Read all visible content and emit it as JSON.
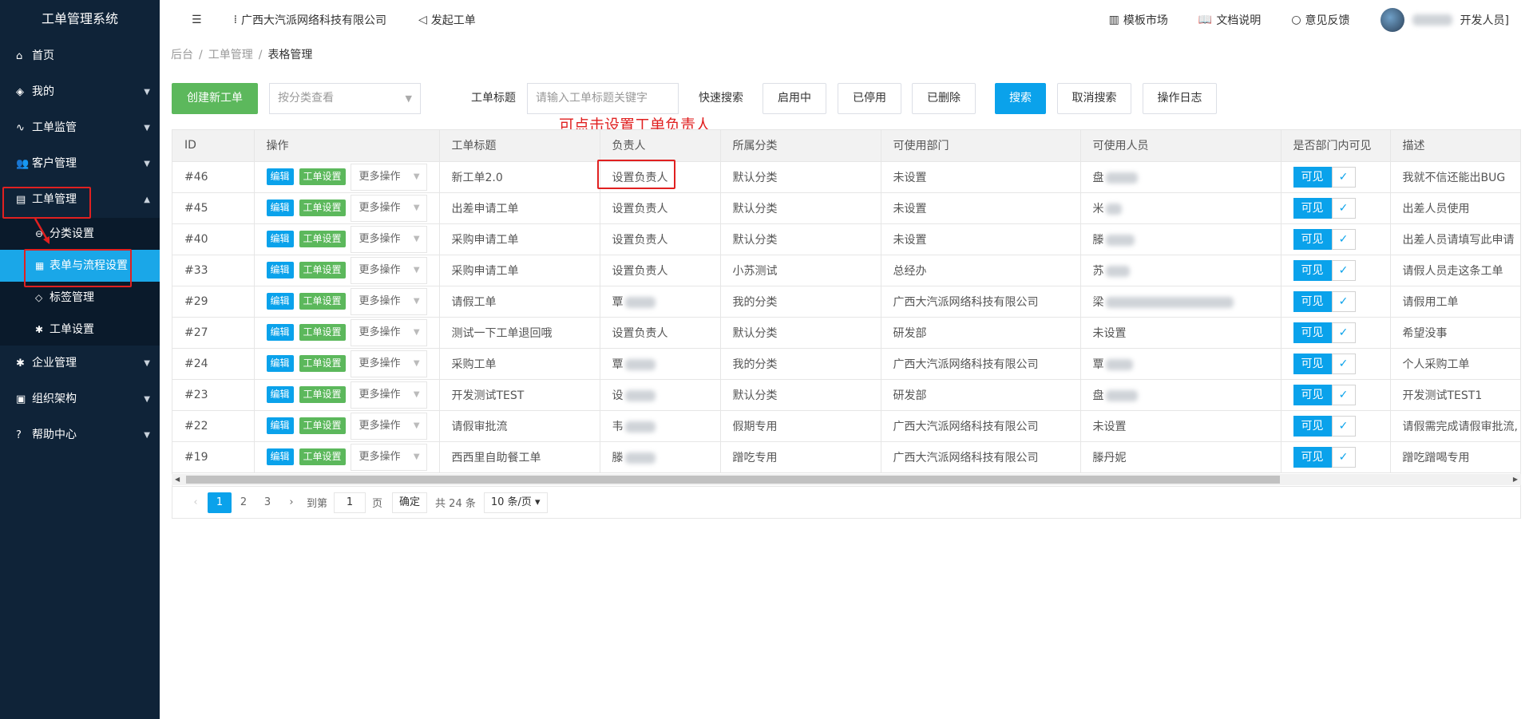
{
  "app_title": "工单管理系统",
  "sidebar": {
    "items": [
      {
        "label": "首页",
        "icon": "home-icon",
        "glyph": "⌂",
        "arrow": ""
      },
      {
        "label": "我的",
        "icon": "layers-icon",
        "glyph": "◈",
        "arrow": "▼"
      },
      {
        "label": "工单监管",
        "icon": "pulse-icon",
        "glyph": "∿",
        "arrow": "▼"
      },
      {
        "label": "客户管理",
        "icon": "users-icon",
        "glyph": "👥",
        "arrow": "▼"
      },
      {
        "label": "工单管理",
        "icon": "clipboard-icon",
        "glyph": "▤",
        "arrow": "▲"
      }
    ],
    "sub_items": [
      {
        "label": "分类设置",
        "glyph": "⊖"
      },
      {
        "label": "表单与流程设置",
        "glyph": "▦"
      },
      {
        "label": "标签管理",
        "glyph": "◇"
      },
      {
        "label": "工单设置",
        "glyph": "✱"
      }
    ],
    "bottom_items": [
      {
        "label": "企业管理",
        "icon": "gear-icon",
        "glyph": "✱",
        "arrow": "▼"
      },
      {
        "label": "组织架构",
        "icon": "org-icon",
        "glyph": "▣",
        "arrow": "▼"
      },
      {
        "label": "帮助中心",
        "icon": "help-icon",
        "glyph": "?",
        "arrow": "▼"
      }
    ]
  },
  "topbar": {
    "menu_icon": "☰",
    "company": "广西大汽派网络科技有限公司",
    "create": "发起工单",
    "market": "模板市场",
    "docs": "文档说明",
    "feedback": "意见反馈",
    "user_role": "开发人员]"
  },
  "breadcrumb": [
    "后台",
    "工单管理",
    "表格管理"
  ],
  "toolbar": {
    "create_button": "创建新工单",
    "category_placeholder": "按分类查看",
    "title_label": "工单标题",
    "title_placeholder": "请输入工单标题关键字",
    "quick_label": "快速搜索",
    "enabled": "启用中",
    "disabled": "已停用",
    "deleted": "已删除",
    "search": "搜索",
    "cancel_search": "取消搜索",
    "log": "操作日志"
  },
  "annotation": "可点击设置工单负责人",
  "table": {
    "headers": [
      "ID",
      "操作",
      "工单标题",
      "负责人",
      "所属分类",
      "可使用部门",
      "可使用人员",
      "是否部门内可见",
      "描述"
    ],
    "edit_label": "编辑",
    "settings_label": "工单设置",
    "more_label": "更多操作",
    "visible_label": "可见",
    "rows": [
      {
        "id": "#46",
        "title": "新工单2.0",
        "owner": "设置负责人",
        "category": "默认分类",
        "dept": "未设置",
        "users": "盘",
        "desc": "我就不信还能出BUG"
      },
      {
        "id": "#45",
        "title": "出差申请工单",
        "owner": "设置负责人",
        "category": "默认分类",
        "dept": "未设置",
        "users": "米",
        "desc": "出差人员使用"
      },
      {
        "id": "#40",
        "title": "采购申请工单",
        "owner": "设置负责人",
        "category": "默认分类",
        "dept": "未设置",
        "users": "滕",
        "desc": "出差人员请填写此申请"
      },
      {
        "id": "#33",
        "title": "采购申请工单",
        "owner": "设置负责人",
        "category": "小苏测试",
        "dept": "总经办",
        "users": "苏",
        "desc": "请假人员走这条工单"
      },
      {
        "id": "#29",
        "title": "请假工单",
        "owner": "覃",
        "category": "我的分类",
        "dept": "广西大汽派网络科技有限公司",
        "users": "梁",
        "desc": "请假用工单"
      },
      {
        "id": "#27",
        "title": "测试一下工单退回哦",
        "owner": "设置负责人",
        "category": "默认分类",
        "dept": "研发部",
        "users": "未设置",
        "desc": "希望没事"
      },
      {
        "id": "#24",
        "title": "采购工单",
        "owner": "覃",
        "category": "我的分类",
        "dept": "广西大汽派网络科技有限公司",
        "users": "覃",
        "desc": "个人采购工单"
      },
      {
        "id": "#23",
        "title": "开发测试TEST",
        "owner": "设",
        "category": "默认分类",
        "dept": "研发部",
        "users": "盘",
        "desc": "开发测试TEST1"
      },
      {
        "id": "#22",
        "title": "请假审批流",
        "owner": "韦",
        "category": "假期专用",
        "dept": "广西大汽派网络科技有限公司",
        "users": "未设置",
        "desc": "请假需完成请假审批流,"
      },
      {
        "id": "#19",
        "title": "西西里自助餐工单",
        "owner": "滕",
        "category": "蹭吃专用",
        "dept": "广西大汽派网络科技有限公司",
        "users": "滕丹妮",
        "desc": "蹭吃蹭喝专用"
      }
    ]
  },
  "pagination": {
    "prev": "‹",
    "pages": [
      "1",
      "2",
      "3"
    ],
    "next": "›",
    "goto": "到第",
    "page_value": "1",
    "page_unit": "页",
    "confirm": "确定",
    "total": "共 24 条",
    "page_size": "10 条/页"
  },
  "colors": {
    "sidebar_bg": "#0f2338",
    "accent": "#0aa2eb",
    "green": "#5cb85c",
    "annotation": "#e02020"
  }
}
